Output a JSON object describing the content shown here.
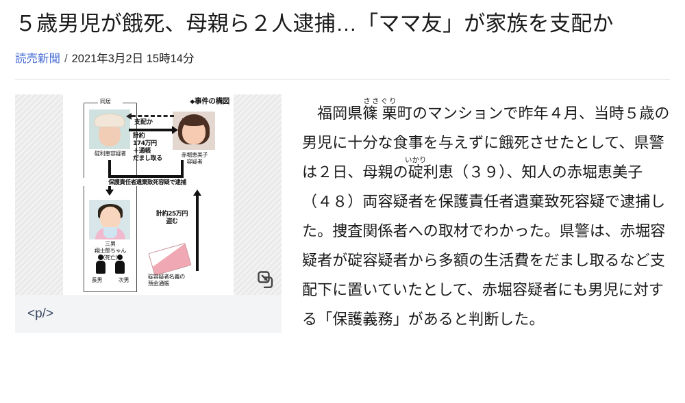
{
  "article": {
    "headline": "５歳男児が餓死、母親ら２人逮捕…「ママ友」が家族を支配か",
    "byline": {
      "source": "読売新聞",
      "separator": "/",
      "timestamp": "2021年3月2日 15時14分",
      "source_color": "#4a6fd4"
    },
    "body": {
      "segments": [
        {
          "type": "text",
          "value": "福岡県"
        },
        {
          "type": "ruby",
          "base": "篠 栗",
          "rt": "ささぐり"
        },
        {
          "type": "text",
          "value": "町のマンションで昨年４月、当時５歳の男児に十分な食事を与えずに餓死させたとして、県警は２日、母親の"
        },
        {
          "type": "ruby",
          "base": "碇",
          "rt": "いかり"
        },
        {
          "type": "text",
          "value": "利恵（３９）、知人の赤堀恵美子（４８）両容疑者を保護責任者遺棄致死容疑で逮捕した。捜査関係者への取材でわかった。県警は、赤堀容疑者が碇容疑者から多額の生活費をだまし取るなど支配下に置いていたとして、赤堀容疑者にも男児に対する「保護義務」があると判断した。"
        }
      ],
      "plain": "福岡県篠栗町のマンションで昨年４月、当時５歳の男児に十分な食事を与えずに餓死させたとして、県警は２日、母親の碇利恵（３９）、知人の赤堀恵美子（４８）両容疑者を保護責任者遺棄致死容疑で逮捕した。捜査関係者への取材でわかった。県警は、赤堀容疑者が碇容疑者から多額の生活費をだまし取るなど支配下に置いていたとして、赤堀容疑者にも男児に対する「保護義務」があると判断した。"
    }
  },
  "figure": {
    "caption": "<p/>",
    "expand_icon": "expand-image-icon",
    "diagram": {
      "title": "事件の構図",
      "title_bullet": "◆",
      "group_label": "同居",
      "photo_captions": {
        "mother": "碇利恵容疑者",
        "friend": "赤堀恵美子\n容疑者",
        "child": "三男\n翔士郎ちゃん\n（死亡）"
      },
      "annotations": {
        "control": "支配か",
        "money_174": "計約\n174万円\n＋通帳\nだまし取る",
        "arrest": "保護責任者遺棄致死容疑で逮捕",
        "money_25": "計約25万円\n盗む",
        "passbook": "碇容疑者名義の\n預金通帳"
      },
      "sons": [
        "長男",
        "次男"
      ]
    }
  }
}
